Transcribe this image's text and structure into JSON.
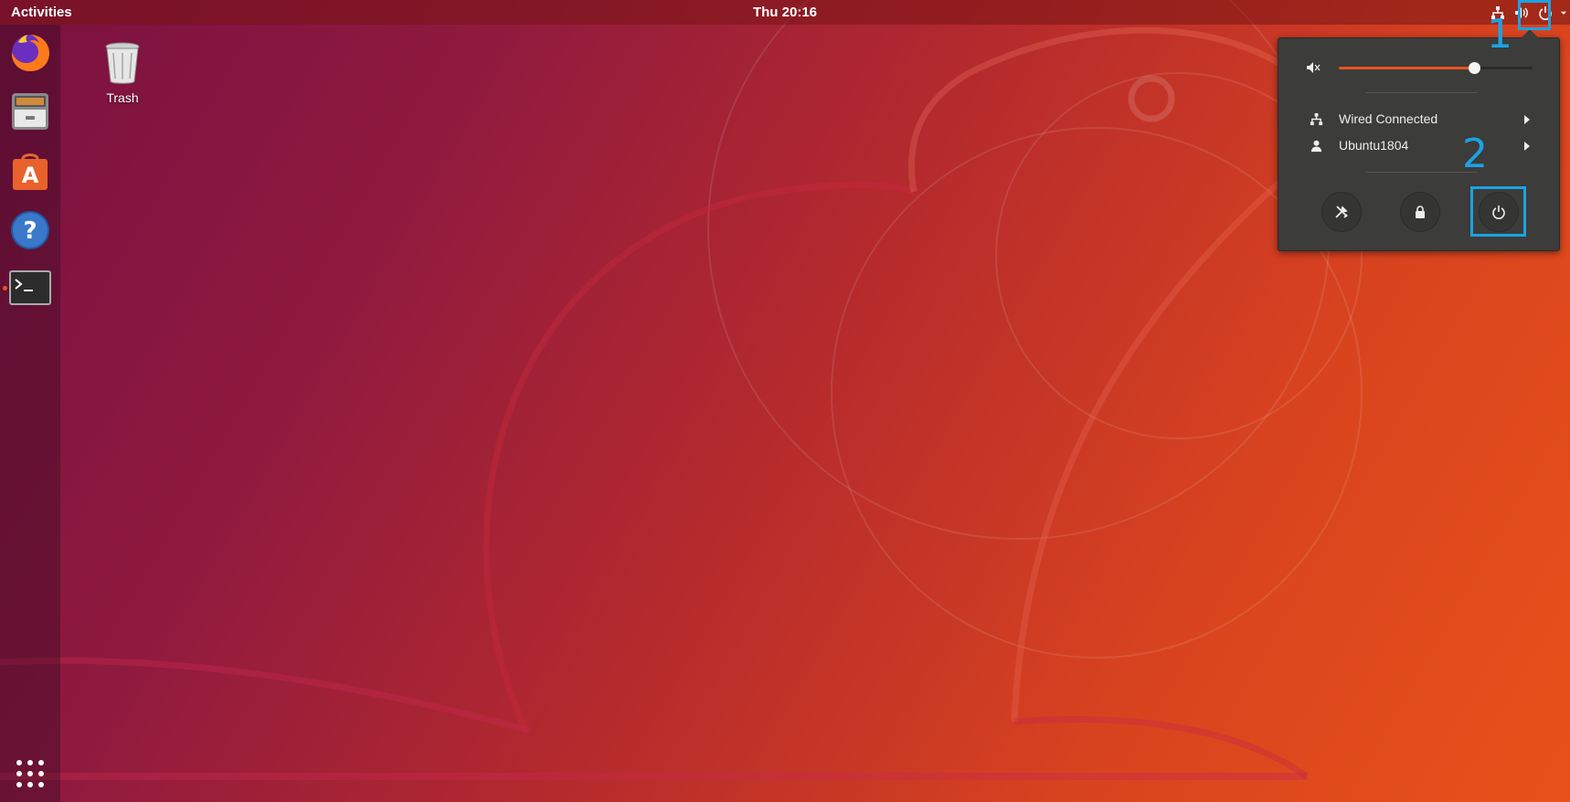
{
  "topbar": {
    "activities_label": "Activities",
    "clock": "Thu 20:16",
    "tray_icons": [
      "network-icon",
      "volume-icon",
      "power-icon",
      "dropdown-arrow-icon"
    ]
  },
  "dock": {
    "items": [
      {
        "name": "firefox-icon",
        "running": false
      },
      {
        "name": "files-icon",
        "running": false
      },
      {
        "name": "software-center-icon",
        "running": false
      },
      {
        "name": "help-icon",
        "running": false
      },
      {
        "name": "terminal-icon",
        "running": true
      }
    ],
    "apps_button": "show-applications-icon"
  },
  "desktop": {
    "trash_label": "Trash"
  },
  "system_menu": {
    "volume_level": 0.7,
    "network_label": "Wired Connected",
    "user_label": "Ubuntu1804",
    "buttons": [
      "settings-icon",
      "lock-icon",
      "power-off-icon"
    ]
  },
  "annotations": {
    "label_1": "1",
    "label_2": "2",
    "color": "#1aa3e6"
  },
  "colors": {
    "accent": "#e95420",
    "menu_bg": "#3c3c3a"
  }
}
